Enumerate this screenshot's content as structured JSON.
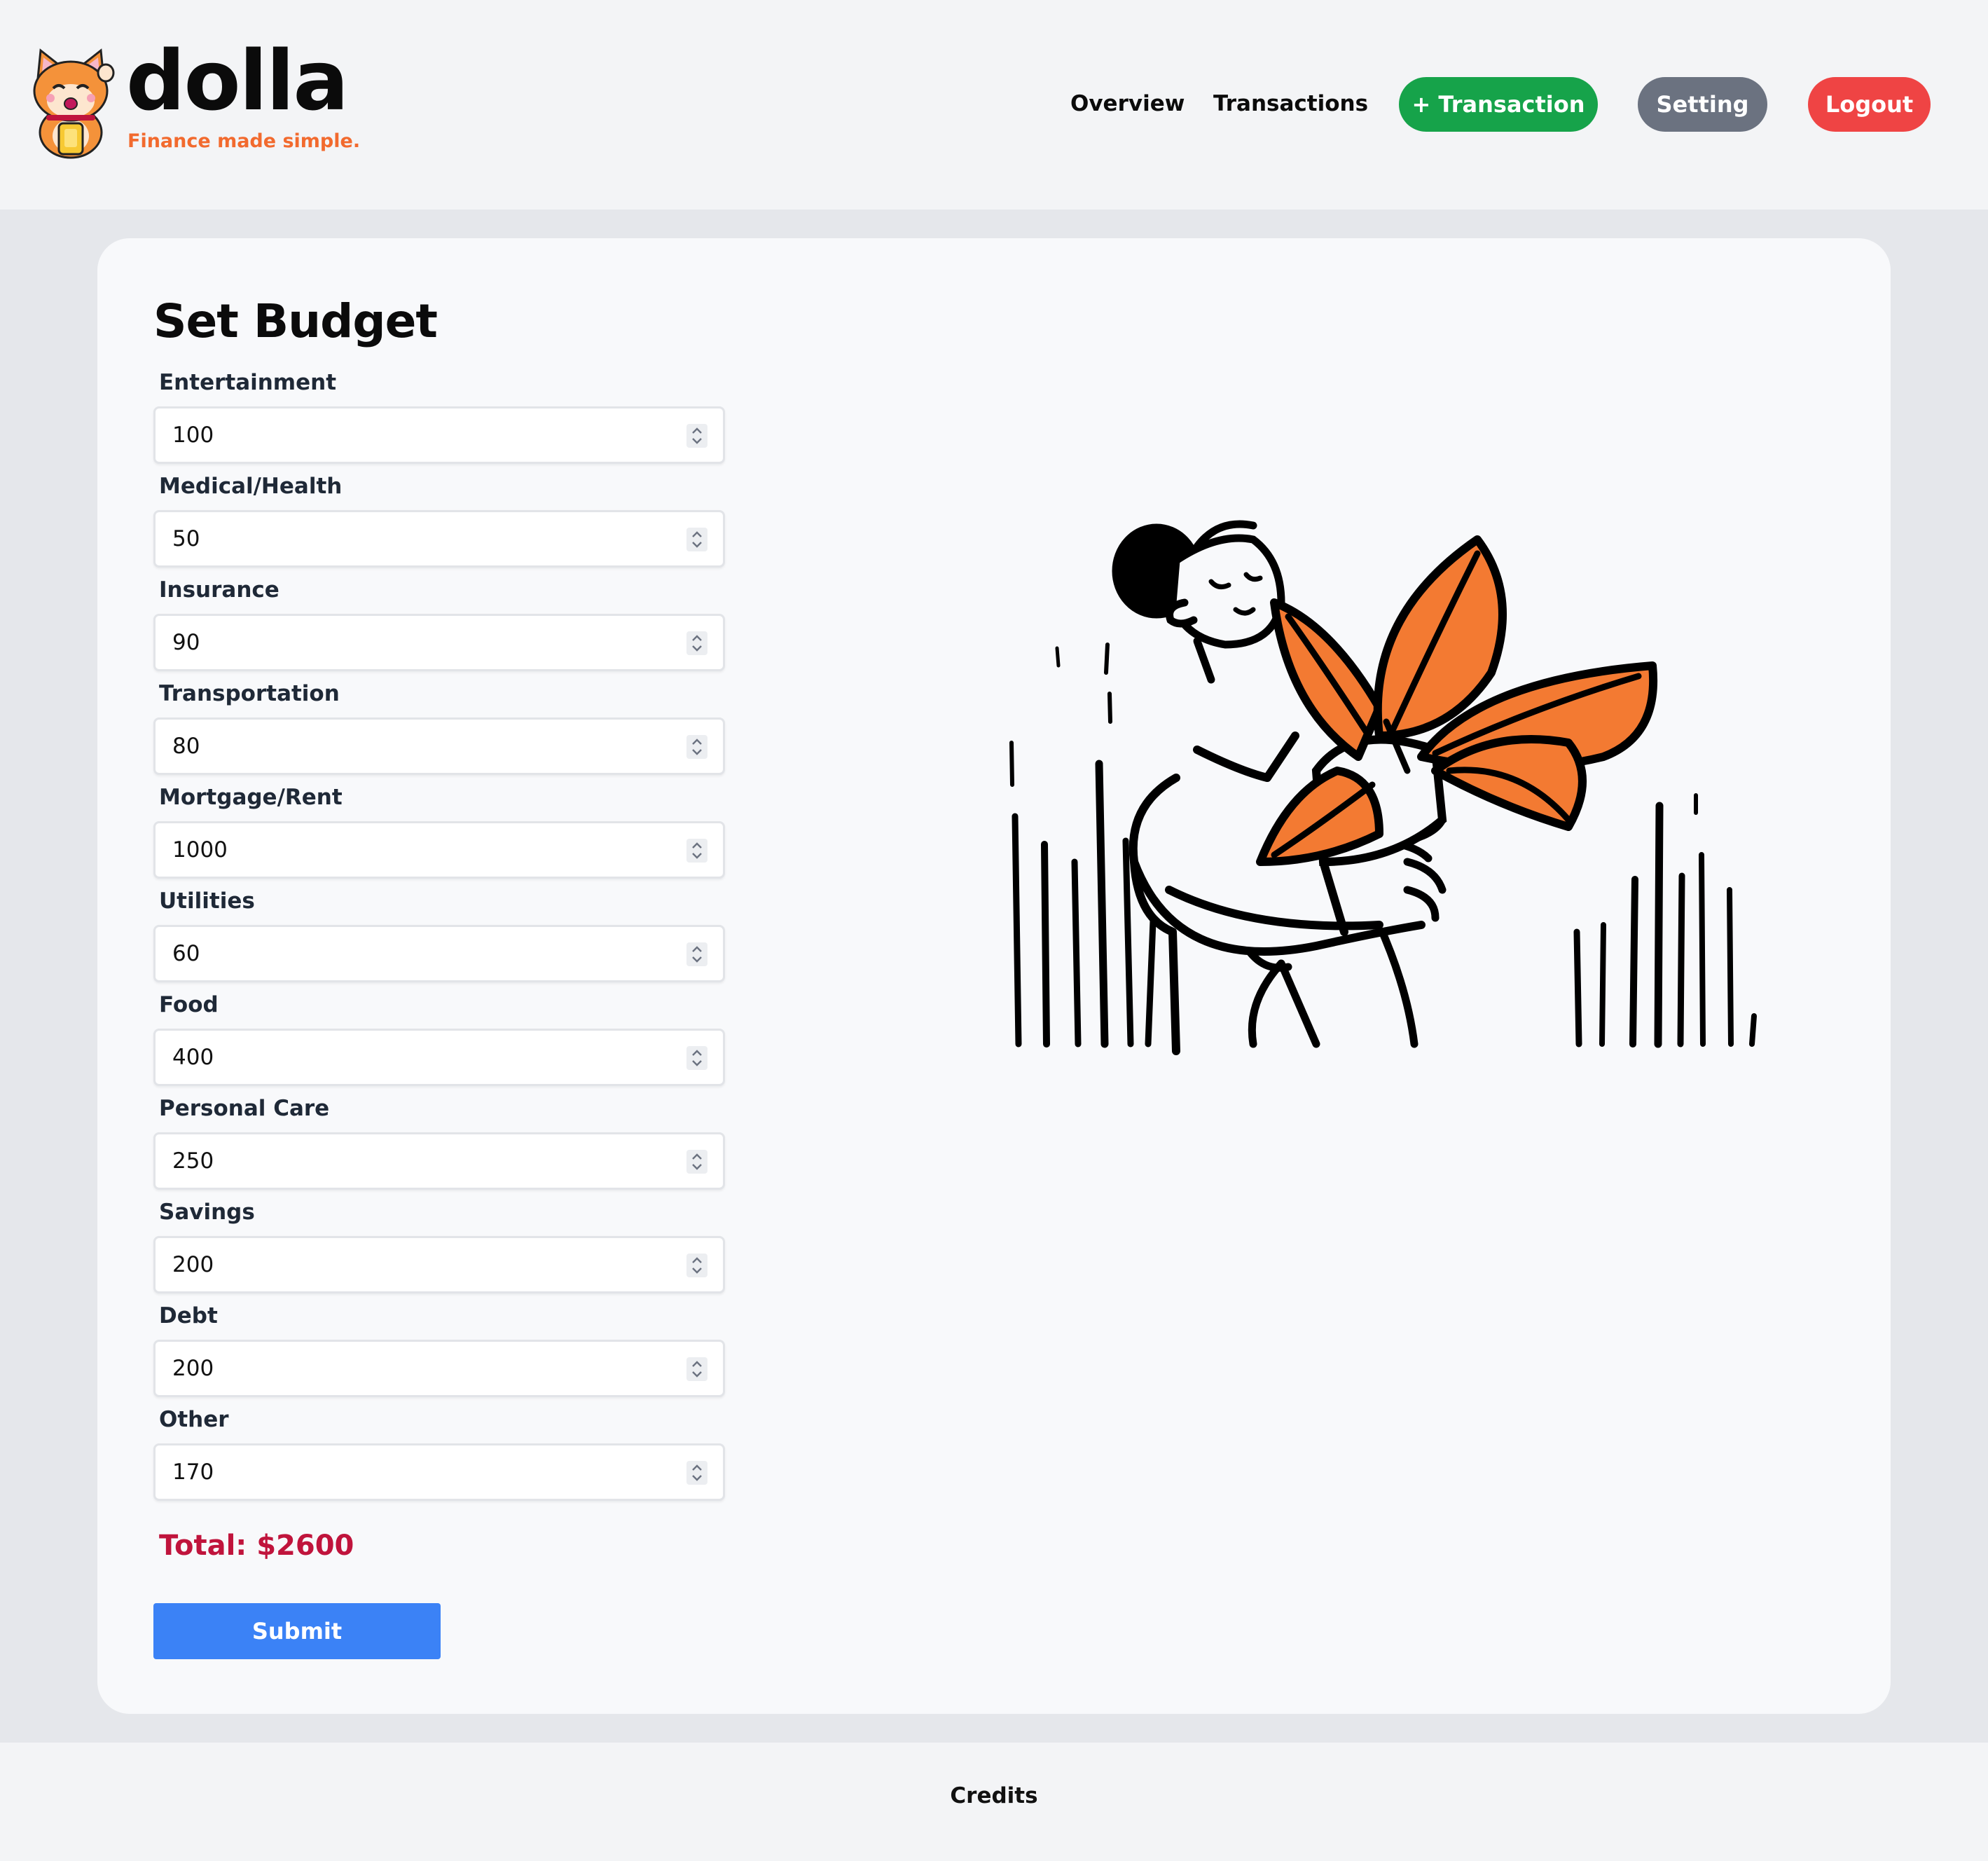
{
  "brand": {
    "name": "dolla",
    "tagline": "Finance made simple."
  },
  "nav": {
    "overview": "Overview",
    "transactions": "Transactions",
    "add_transaction": "+ Transaction",
    "setting": "Setting",
    "logout": "Logout"
  },
  "colors": {
    "add_transaction": "#16a34a",
    "setting": "#6b7280",
    "logout": "#ef4444",
    "submit": "#3b82f6",
    "total": "#c0143c",
    "accent_orange": "#f37a32"
  },
  "form": {
    "title": "Set Budget",
    "fields": [
      {
        "label": "Entertainment",
        "value": "100"
      },
      {
        "label": "Medical/Health",
        "value": "50"
      },
      {
        "label": "Insurance",
        "value": "90"
      },
      {
        "label": "Transportation",
        "value": "80"
      },
      {
        "label": "Mortgage/Rent",
        "value": "1000"
      },
      {
        "label": "Utilities",
        "value": "60"
      },
      {
        "label": "Food",
        "value": "400"
      },
      {
        "label": "Personal Care",
        "value": "250"
      },
      {
        "label": "Savings",
        "value": "200"
      },
      {
        "label": "Debt",
        "value": "200"
      },
      {
        "label": "Other",
        "value": "170"
      }
    ],
    "total": "Total: $2600",
    "submit_label": "Submit"
  },
  "footer": {
    "credits": "Credits"
  }
}
